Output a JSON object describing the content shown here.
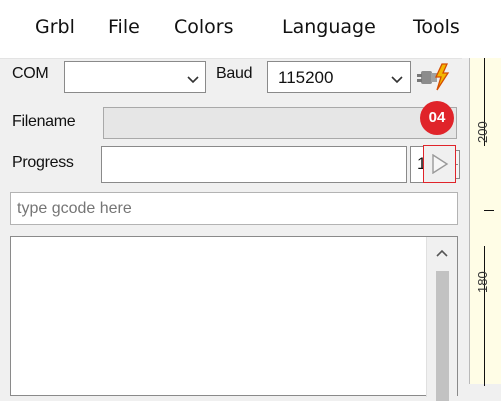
{
  "menu": {
    "items": [
      "Grbl",
      "File",
      "Colors",
      "Language",
      "Tools"
    ]
  },
  "connection": {
    "com_label": "COM",
    "com_value": "",
    "baud_label": "Baud",
    "baud_value": "115200"
  },
  "filename": {
    "label": "Filename",
    "value": ""
  },
  "progress": {
    "label": "Progress",
    "value": "",
    "count_value": "1"
  },
  "gcode_input": {
    "placeholder": "type gcode here"
  },
  "ruler": {
    "labels": [
      "200",
      "180"
    ]
  },
  "annotation": {
    "badge": "04"
  },
  "colors": {
    "badge": "#e0242a",
    "ruler_bg": "#fffde6",
    "highlight_border": "#e0242a",
    "connect_icon": "#e0a100"
  },
  "icons": {
    "connect": "lightning-plug-icon",
    "send": "play-icon",
    "stepper": "up-down-icon",
    "scroll_up": "chevron-up-icon"
  }
}
